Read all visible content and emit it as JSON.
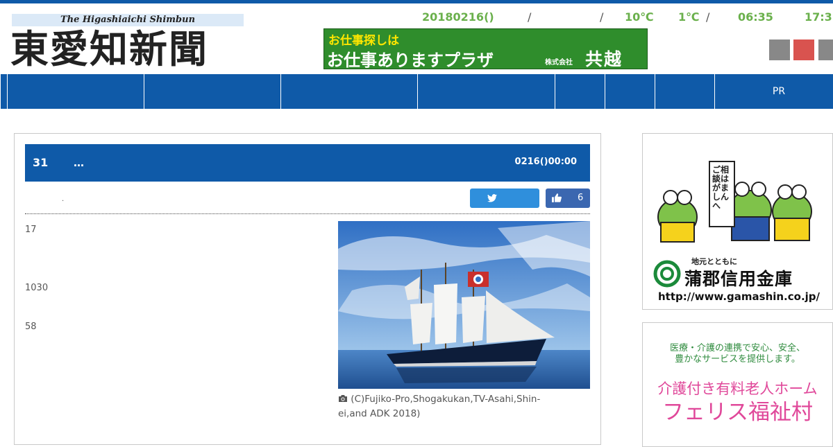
{
  "header": {
    "logo_subtitle": "The Higashiaichi Shimbun",
    "logo_title": "東愛知新聞",
    "date": "20180216()",
    "sep1": "/",
    "sep2": "/",
    "sep3": "/",
    "temp_high": "10℃",
    "temp_low": "1℃",
    "sunrise": "06:35",
    "sunset": "17:3"
  },
  "banner": {
    "line1": "お仕事探しは",
    "line2": "お仕事ありますプラザ",
    "company_type": "株式会社",
    "company": "共越"
  },
  "font_buttons": {
    "colors": [
      "#888888",
      "#d9534f",
      "#888888"
    ]
  },
  "nav": {
    "items": [
      "",
      "",
      "",
      "",
      "",
      "",
      "",
      "",
      "PR"
    ]
  },
  "article": {
    "number": "31",
    "title": "…",
    "date": "0216()00:00",
    "dot": ".",
    "like_count": "6",
    "paragraphs": [
      "17",
      "1030",
      "58"
    ],
    "photo_caption": "(C)Fujiko-Pro,Shogakukan,TV-Asahi,Shin-ei,and ADK 2018)"
  },
  "ads": {
    "gamagori": {
      "bubble": "ご相談はがましんへ",
      "tagline": "地元とともに",
      "name": "蒲郡信用金庫",
      "url": "http://www.gamashin.co.jp/"
    },
    "feris": {
      "line1": "医療・介護の連携で安心、安全、",
      "line2": "豊かなサービスを提供します。",
      "line3": "介護付き有料老人ホーム",
      "line4": "フェリス福祉村"
    }
  },
  "colors": {
    "brand_blue": "#0f5aa8",
    "info_green": "#6ab04c",
    "twitter": "#2f8fdc",
    "like": "#3b67b0"
  }
}
